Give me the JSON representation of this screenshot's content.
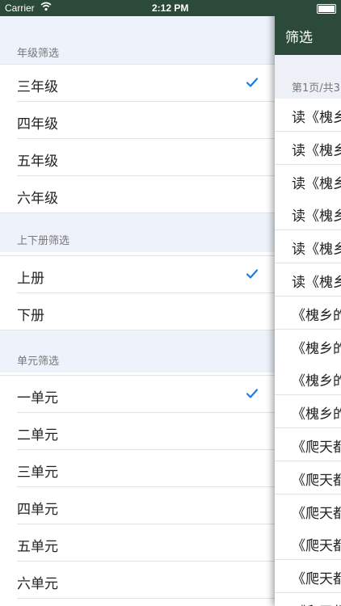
{
  "status_bar": {
    "carrier": "Carrier",
    "time": "2:12 PM"
  },
  "filters": {
    "grade": {
      "header": "年级筛选",
      "options": [
        {
          "label": "三年级",
          "selected": true
        },
        {
          "label": "四年级",
          "selected": false
        },
        {
          "label": "五年级",
          "selected": false
        },
        {
          "label": "六年级",
          "selected": false
        }
      ]
    },
    "volume": {
      "header": "上下册筛选",
      "options": [
        {
          "label": "上册",
          "selected": true
        },
        {
          "label": "下册",
          "selected": false
        }
      ]
    },
    "unit": {
      "header": "单元筛选",
      "options": [
        {
          "label": "一单元",
          "selected": true
        },
        {
          "label": "二单元",
          "selected": false
        },
        {
          "label": "三单元",
          "selected": false
        },
        {
          "label": "四单元",
          "selected": false
        },
        {
          "label": "五单元",
          "selected": false
        },
        {
          "label": "六单元",
          "selected": false
        }
      ]
    }
  },
  "panel": {
    "nav_title": "筛选",
    "page_info": "第1页/共3",
    "items": [
      "读《槐乡",
      "读《槐乡",
      "读《槐乡",
      "读《槐乡",
      "读《槐乡",
      "读《槐乡",
      "《槐乡的",
      "《槐乡的",
      "《槐乡的",
      "《槐乡的",
      "《爬天都",
      "《爬天都",
      "《爬天都",
      "《爬天都",
      "《爬天都",
      "《爬天都"
    ]
  },
  "colors": {
    "nav": "#2c4a3a",
    "check": "#1a7de0",
    "group_bg": "#eef2fb"
  }
}
